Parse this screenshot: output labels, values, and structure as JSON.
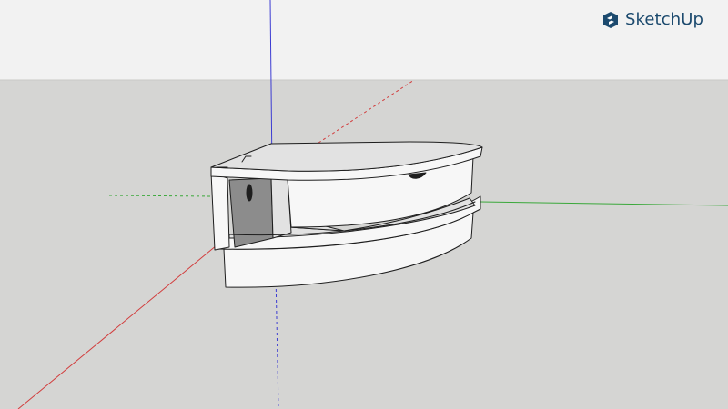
{
  "app": {
    "name": "SketchUp",
    "logo_icon": "sketchup-logo-icon"
  },
  "colors": {
    "sky": "#f2f2f2",
    "ground": "#d5d5d3",
    "horizon": "#c9c9c7",
    "axis_red": "#d23c3c",
    "axis_green": "#3aa83a",
    "axis_blue": "#3c3cd2",
    "model_face": "#f7f7f7",
    "model_shade": "#e2e2e2",
    "model_dark": "#8c8c8c",
    "model_edge": "#1e1e1e",
    "brand": "#1c4a6e"
  },
  "scene": {
    "axes": [
      "red-axis",
      "green-axis",
      "blue-axis"
    ],
    "model": "corner-shelf"
  }
}
